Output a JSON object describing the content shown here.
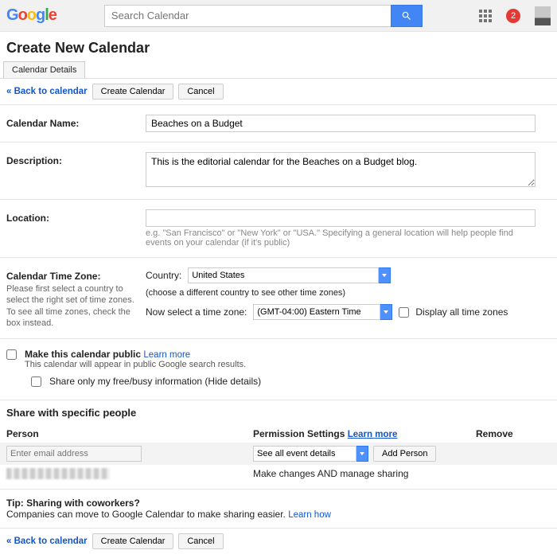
{
  "header": {
    "search_placeholder": "Search Calendar",
    "notification_count": "2"
  },
  "page_title": "Create New Calendar",
  "tab_label": "Calendar Details",
  "actions": {
    "back_link": "« Back to calendar",
    "create_btn": "Create Calendar",
    "cancel_btn": "Cancel"
  },
  "form": {
    "name_label": "Calendar Name:",
    "name_value": "Beaches on a Budget",
    "desc_label": "Description:",
    "desc_value": "This is the editorial calendar for the Beaches on a Budget blog.",
    "location_label": "Location:",
    "location_value": "",
    "location_hint": "e.g. \"San Francisco\" or \"New York\" or \"USA.\" Specifying a general location will help people find events on your calendar (if it's public)",
    "tz_label": "Calendar Time Zone:",
    "tz_hint": "Please first select a country to select the right set of time zones. To see all time zones, check the box instead.",
    "country_label": "Country:",
    "country_value": "United States",
    "country_hint": "(choose a different country to see other time zones)",
    "tz_select_label": "Now select a time zone:",
    "tz_value": "(GMT-04:00) Eastern Time",
    "display_all_tz": "Display all time zones"
  },
  "public": {
    "make_public_label": "Make this calendar public",
    "learn_more": "Learn more",
    "public_hint": "This calendar will appear in public Google search results.",
    "share_freebusy": "Share only my free/busy information (Hide details)"
  },
  "share": {
    "heading": "Share with specific people",
    "col_person": "Person",
    "col_permission": "Permission Settings",
    "learn_more": "Learn more",
    "col_remove": "Remove",
    "email_placeholder": "Enter email address",
    "perm_default": "See all event details",
    "add_person_btn": "Add Person",
    "existing_perm": "Make changes AND manage sharing"
  },
  "tip": {
    "heading": "Tip: Sharing with coworkers?",
    "text": "Companies can move to Google Calendar to make sharing easier.",
    "learn_how": "Learn how"
  }
}
